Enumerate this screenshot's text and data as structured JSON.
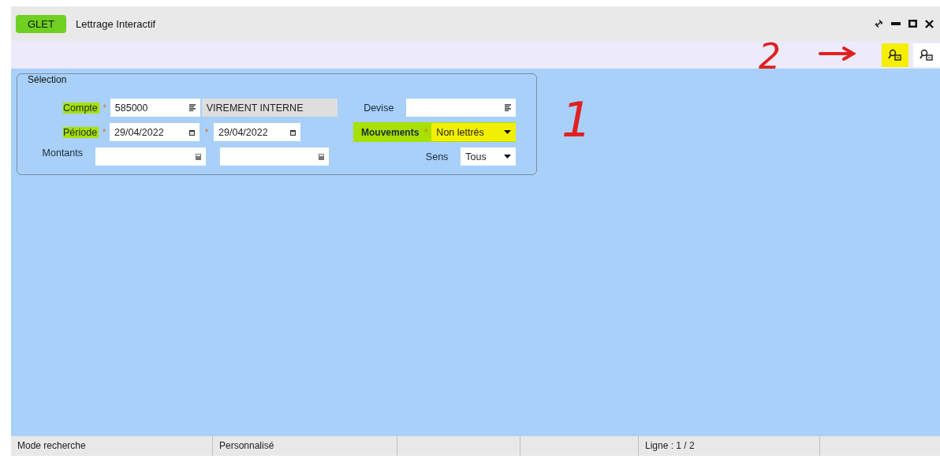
{
  "window": {
    "badge": "GLET",
    "title": "Lettrage Interactif"
  },
  "toolbar": {
    "buttons": [
      {
        "highlighted": true
      },
      {
        "highlighted": false
      }
    ]
  },
  "selection": {
    "title": "Sélection",
    "compte": {
      "label": "Compte",
      "required_mark": "*",
      "highlighted": true,
      "value": "585000",
      "name": "VIREMENT INTERNE"
    },
    "periode": {
      "label": "Période",
      "required_mark": "*",
      "highlighted": true,
      "from": "29/04/2022",
      "to": "29/04/2022",
      "to_required_mark": "*"
    },
    "montants": {
      "label": "Montants"
    },
    "devise": {
      "label": "Devise",
      "highlighted": false
    },
    "mouvements": {
      "label": "Mouvements",
      "required_mark": "*",
      "highlighted": true,
      "value": "Non lettrés"
    },
    "sens": {
      "label": "Sens",
      "highlighted": false,
      "value": "Tous"
    }
  },
  "annotations": [
    "1",
    "2"
  ],
  "status_bar": [
    "Mode recherche",
    "Personnalisé",
    "Ligne : 1 / 2"
  ]
}
